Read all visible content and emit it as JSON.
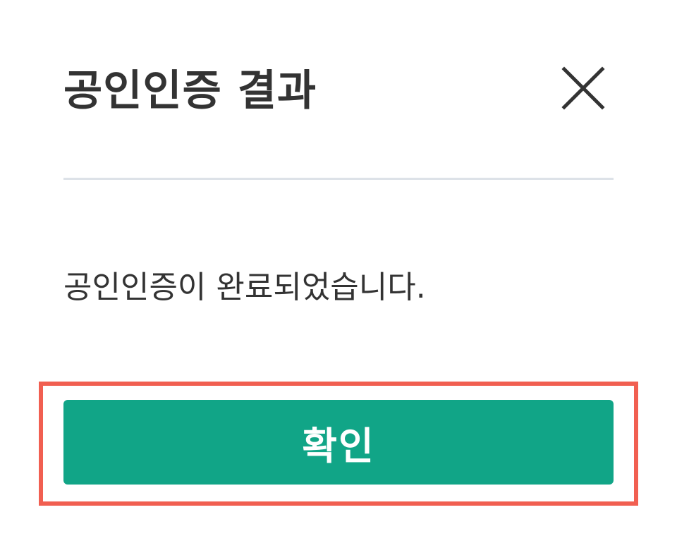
{
  "dialog": {
    "title": "공인인증 결과",
    "message": "공인인증이 완료되었습니다.",
    "confirm_label": "확인",
    "close_icon": "close-icon"
  },
  "colors": {
    "title_text": "#333333",
    "divider": "#dde2e8",
    "confirm_button": "#11a587",
    "highlight_frame": "#f15f51"
  }
}
